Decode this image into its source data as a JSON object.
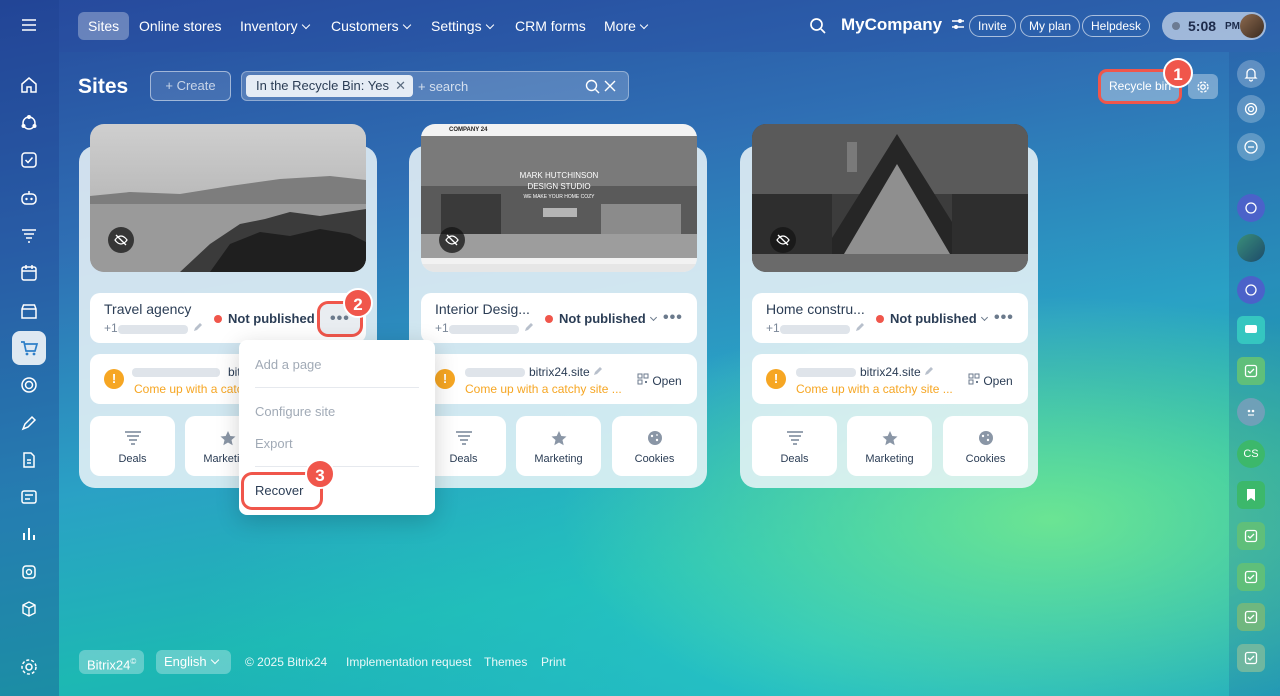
{
  "nav": {
    "items": [
      "Sites",
      "Online stores",
      "Inventory",
      "Customers",
      "Settings",
      "CRM forms",
      "More"
    ],
    "company": "MyCompany",
    "invite": "Invite",
    "my_plan": "My plan",
    "helpdesk": "Helpdesk",
    "time": "5:08",
    "ampm": "PM"
  },
  "header": {
    "title": "Sites",
    "create_label": "Create",
    "filter_chip": "In the Recycle Bin: Yes",
    "search_placeholder": "+ search",
    "recycle_bin_label": "Recycle bin"
  },
  "badges": [
    "1",
    "2",
    "3"
  ],
  "sites": [
    {
      "name": "Travel agency",
      "phone_prefix": "+1",
      "status": "Not published",
      "domain": "bitrix24",
      "warning": "Come up with a catchy site name",
      "open": "",
      "tiles": [
        "Deals",
        "Marketing"
      ]
    },
    {
      "name": "Interior Desig...",
      "phone_prefix": "+1",
      "status": "Not published",
      "domain": "bitrix24.site",
      "warning": "Come up with a catchy site ...",
      "open": "Open",
      "tiles": [
        "Deals",
        "Marketing",
        "Cookies"
      ],
      "preview": {
        "brand": "COMPANY 24",
        "headline_1": "MARK HUTCHINSON",
        "headline_2": "DESIGN STUDIO",
        "tagline": "WE MAKE YOUR HOME COZY"
      }
    },
    {
      "name": "Home constru...",
      "phone_prefix": "+1",
      "status": "Not published",
      "domain": "bitrix24.site",
      "warning": "Come up with a catchy site ...",
      "open": "Open",
      "tiles": [
        "Deals",
        "Marketing",
        "Cookies"
      ]
    }
  ],
  "menu": {
    "add_page": "Add a page",
    "configure": "Configure site",
    "export": "Export",
    "recover": "Recover"
  },
  "footer": {
    "brand": "Bitrix24",
    "language": "English",
    "copyright": "© 2025 Bitrix24",
    "implementation": "Implementation request",
    "themes": "Themes",
    "print": "Print"
  },
  "right_bar": {
    "cs_label": "CS"
  },
  "colors": {
    "accent_red": "#f0564b",
    "warning": "#f6a623",
    "text_dark": "#2b3d55"
  }
}
